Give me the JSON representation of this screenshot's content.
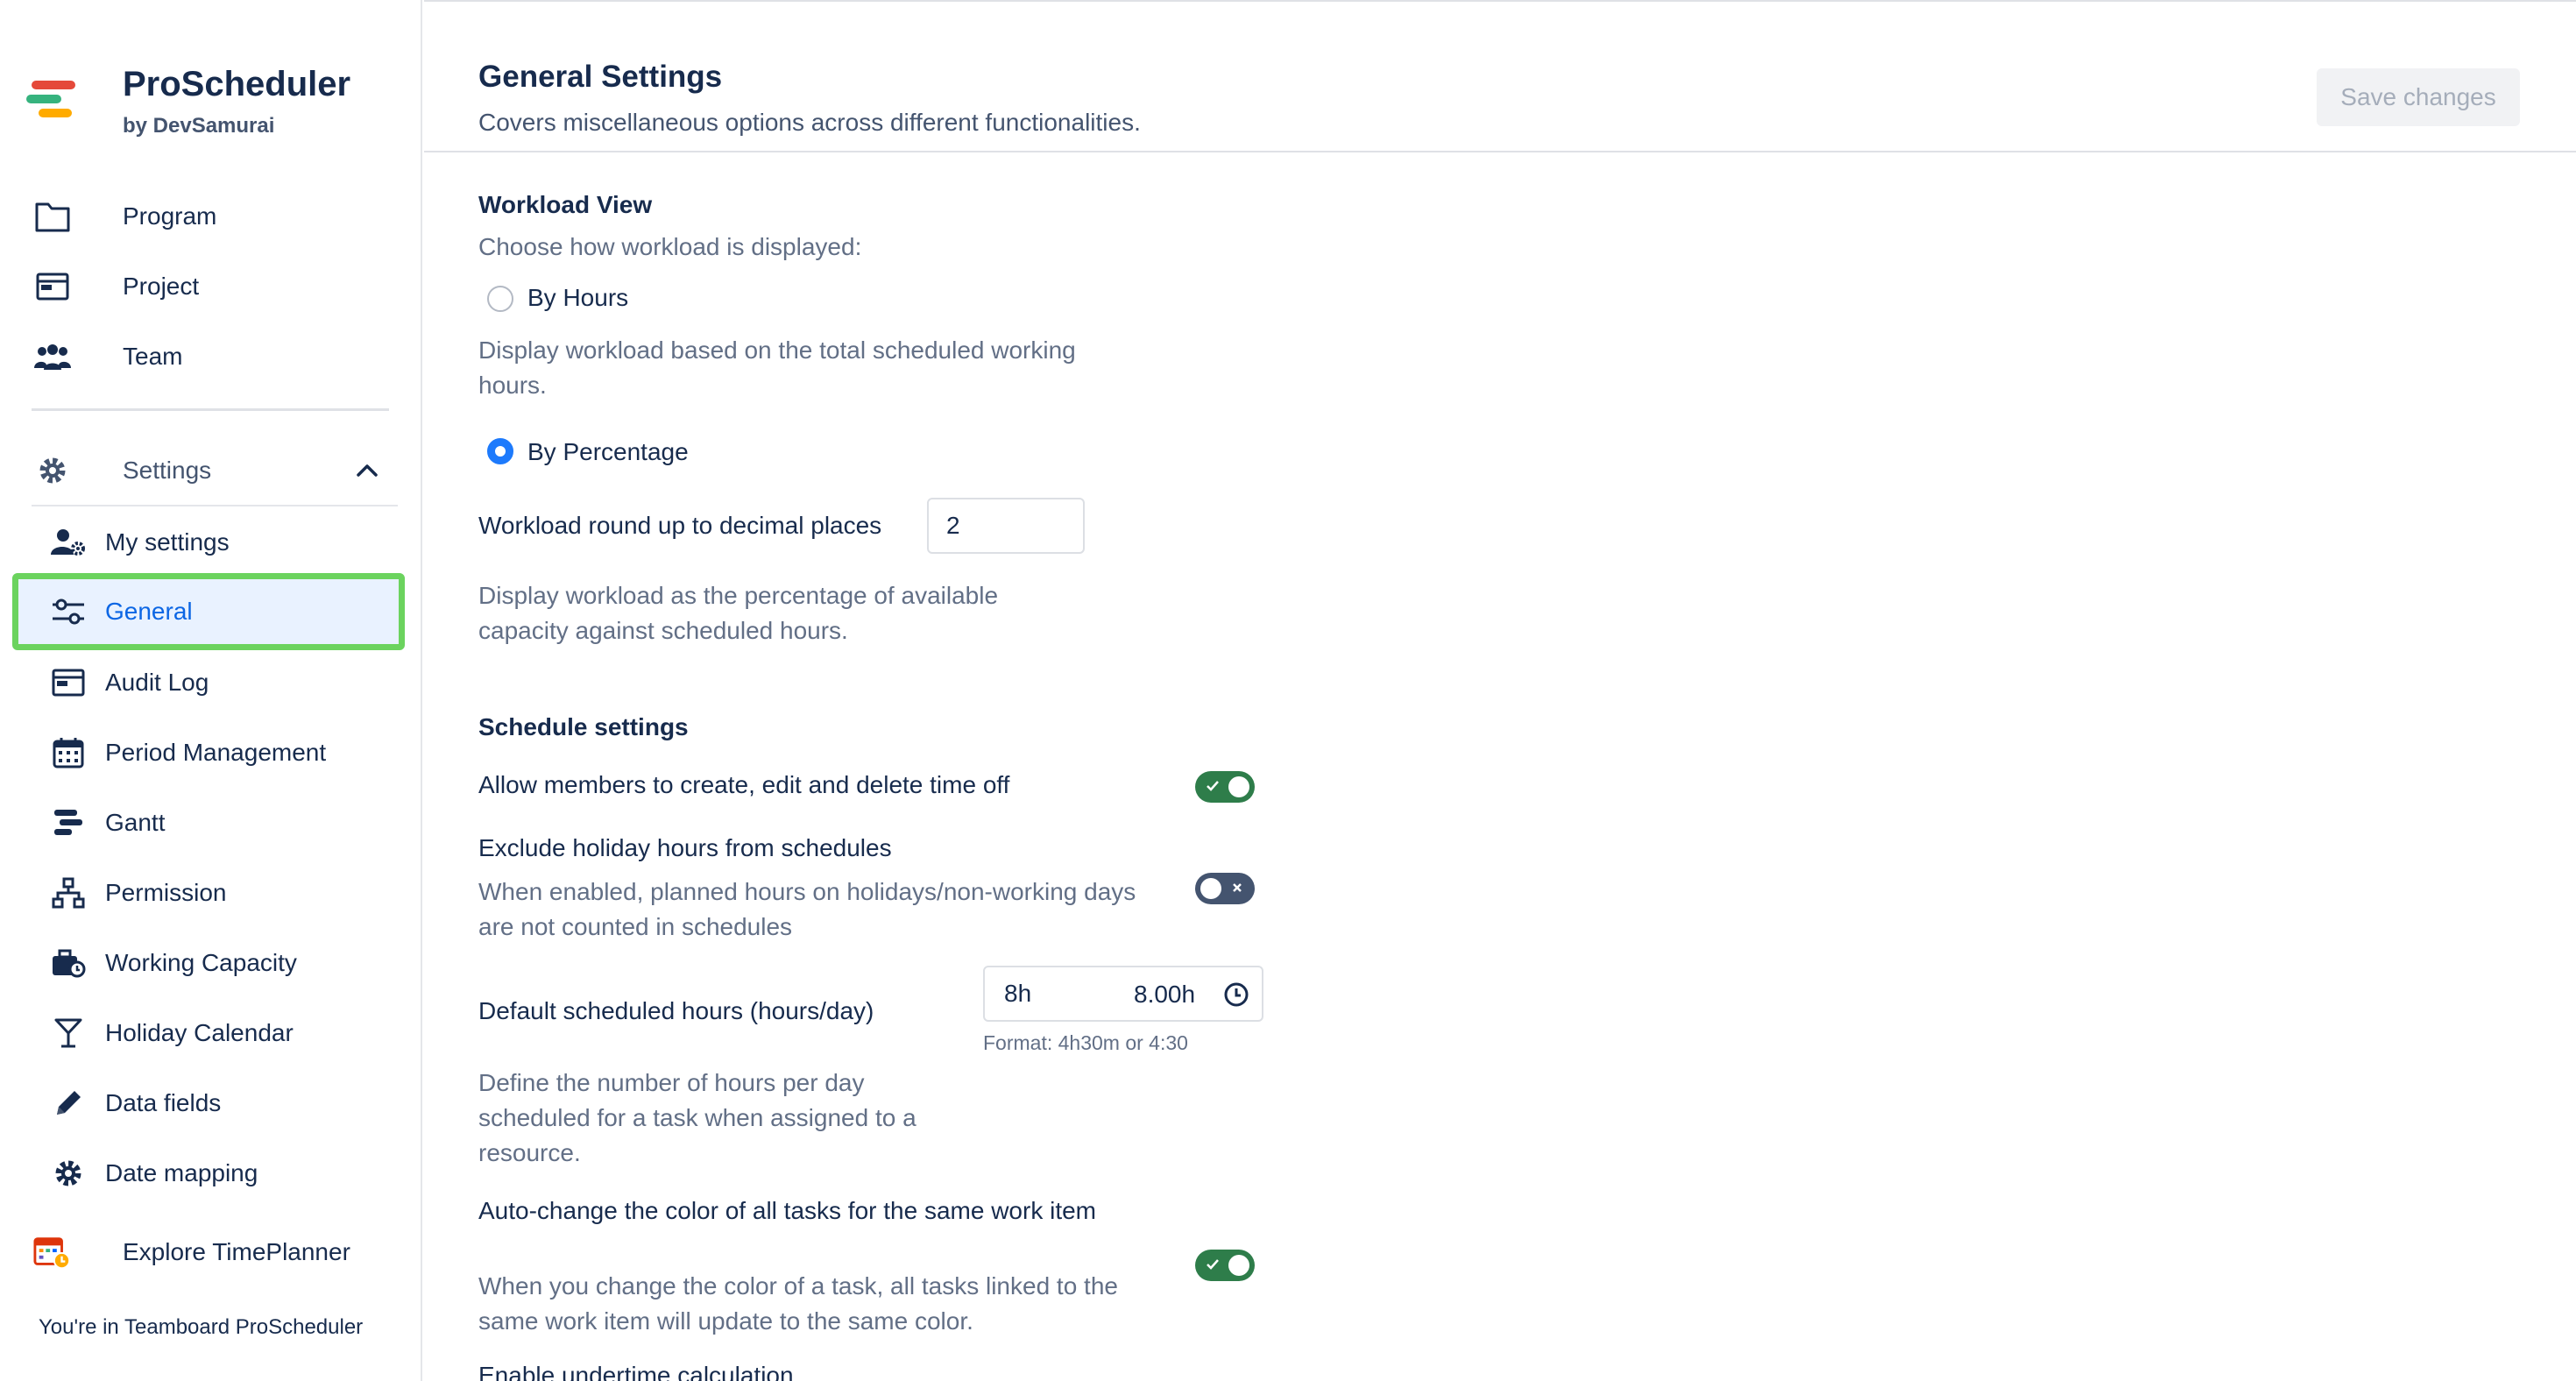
{
  "brand": {
    "title": "ProScheduler",
    "subtitle": "by DevSamurai",
    "logo_colors": [
      "#e5493a",
      "#36b37e",
      "#ffab00"
    ]
  },
  "nav": {
    "items": [
      {
        "label": "Program",
        "icon": "folder-icon"
      },
      {
        "label": "Project",
        "icon": "window-icon"
      },
      {
        "label": "Team",
        "icon": "team-icon"
      }
    ],
    "settings": {
      "label": "Settings",
      "icon": "gear-icon",
      "expanded": true
    },
    "settings_items": [
      {
        "label": "My settings",
        "icon": "user-settings-icon"
      },
      {
        "label": "General",
        "icon": "sliders-icon",
        "active": true
      },
      {
        "label": "Audit Log",
        "icon": "window-icon"
      },
      {
        "label": "Period Management",
        "icon": "calendar-icon"
      },
      {
        "label": "Gantt",
        "icon": "gantt-icon"
      },
      {
        "label": "Permission",
        "icon": "hierarchy-icon"
      },
      {
        "label": "Working Capacity",
        "icon": "briefcase-clock-icon"
      },
      {
        "label": "Holiday Calendar",
        "icon": "cocktail-icon"
      },
      {
        "label": "Data fields",
        "icon": "pencil-icon"
      },
      {
        "label": "Date mapping",
        "icon": "gear-icon"
      }
    ],
    "explore": {
      "label": "Explore TimePlanner",
      "icon": "calendar-clock-icon"
    },
    "footer": "You're in Teamboard ProScheduler"
  },
  "header": {
    "title": "General Settings",
    "subtitle": "Covers miscellaneous options across different functionalities.",
    "save_label": "Save changes"
  },
  "workload": {
    "title": "Workload View",
    "prompt": "Choose how workload is displayed:",
    "by_hours_label": "By Hours",
    "by_hours_desc": "Display workload based on the total scheduled working hours.",
    "by_percentage_label": "By Percentage",
    "selected": "By Percentage",
    "round_label": "Workload round up to decimal places",
    "round_value": "2",
    "percentage_desc": "Display workload as the percentage of available capacity against scheduled hours."
  },
  "schedule": {
    "title": "Schedule settings",
    "allow_timeoff_label": "Allow members to create, edit and delete time off",
    "allow_timeoff_on": true,
    "exclude_holiday_label": "Exclude holiday hours from schedules",
    "exclude_holiday_desc": "When enabled, planned hours on holidays/non-working days are not counted in schedules",
    "exclude_holiday_on": false,
    "default_hours_label": "Default scheduled hours (hours/day)",
    "default_hours_value": "8h",
    "default_hours_calc": "8.00h",
    "default_hours_format": "Format: 4h30m or 4:30",
    "default_hours_desc": "Define the number of hours per day scheduled for a task when assigned to a resource.",
    "auto_color_label": "Auto-change the color of all tasks for the same work item",
    "auto_color_desc": "When you change the color of a task, all tasks linked to the same work item will update to the same color.",
    "auto_color_on": true,
    "undertime_label": "Enable undertime calculation"
  },
  "colors": {
    "accent": "#0c66e4",
    "highlight_border": "#6bd35e",
    "toggle_on": "#2e7d4a",
    "toggle_off": "#44546f",
    "radio_checked": "#1d7afc"
  }
}
